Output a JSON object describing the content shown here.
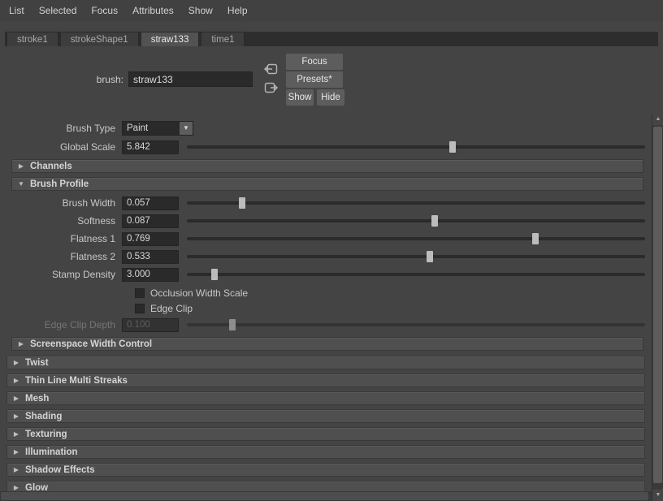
{
  "menubar": {
    "items": [
      "List",
      "Selected",
      "Focus",
      "Attributes",
      "Show",
      "Help"
    ]
  },
  "tabs": [
    "stroke1",
    "strokeShape1",
    "straw133",
    "time1"
  ],
  "header": {
    "brush_label": "brush:",
    "brush_value": "straw133",
    "focus_btn": "Focus",
    "presets_btn": "Presets*",
    "show_btn": "Show",
    "hide_btn": "Hide"
  },
  "rows": {
    "brush_type": {
      "label": "Brush Type",
      "value": "Paint"
    },
    "global_scale": {
      "label": "Global Scale",
      "value": "5.842",
      "pos": 58
    },
    "brush_width": {
      "label": "Brush Width",
      "value": "0.057",
      "pos": 12
    },
    "softness": {
      "label": "Softness",
      "value": "0.087",
      "pos": 54
    },
    "flatness1": {
      "label": "Flatness 1",
      "value": "0.769",
      "pos": 76
    },
    "flatness2": {
      "label": "Flatness 2",
      "value": "0.533",
      "pos": 53
    },
    "stamp_density": {
      "label": "Stamp Density",
      "value": "3.000",
      "pos": 6
    },
    "occlusion": {
      "label": "Occlusion Width Scale",
      "checked": false
    },
    "edge_clip": {
      "label": "Edge Clip",
      "checked": false
    },
    "edge_clip_depth": {
      "label": "Edge Clip Depth",
      "value": "0.100",
      "pos": 10
    }
  },
  "sections": {
    "channels": {
      "label": "Channels"
    },
    "brush_profile": {
      "label": "Brush Profile"
    },
    "screenspace": {
      "label": "Screenspace Width Control"
    },
    "twist": {
      "label": "Twist"
    },
    "thin_line": {
      "label": "Thin Line Multi Streaks"
    },
    "mesh": {
      "label": "Mesh"
    },
    "shading": {
      "label": "Shading"
    },
    "texturing": {
      "label": "Texturing"
    },
    "illumination": {
      "label": "Illumination"
    },
    "shadow_effects": {
      "label": "Shadow Effects"
    },
    "glow": {
      "label": "Glow"
    }
  },
  "icons": {
    "collapsed": "▶",
    "expanded": "▼",
    "dropdown": "▼",
    "scroll_up": "▲",
    "scroll_down": "▼"
  },
  "colors": {
    "background": "#444444",
    "field_bg": "#2a2a2a",
    "button_bg": "#5d5d5d",
    "handle": "#bcbcbc"
  }
}
